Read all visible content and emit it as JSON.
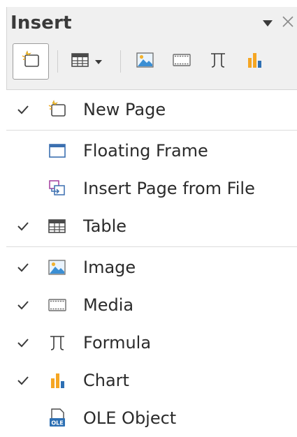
{
  "panel": {
    "title": "Insert",
    "menu_icon": "triangle-down-icon",
    "close_icon": "close-icon"
  },
  "toolbar": {
    "buttons": [
      {
        "id": "new-page",
        "icon": "new-page-icon",
        "active": true
      },
      {
        "id": "table",
        "icon": "table-icon",
        "has_dropdown": true
      },
      {
        "id": "image",
        "icon": "image-icon"
      },
      {
        "id": "media",
        "icon": "media-icon"
      },
      {
        "id": "formula",
        "icon": "formula-icon"
      },
      {
        "id": "chart",
        "icon": "chart-icon"
      }
    ]
  },
  "menu": {
    "items": [
      {
        "label": "New Page",
        "checked": true,
        "icon": "new-page-icon"
      },
      {
        "separator": true
      },
      {
        "label": "Floating Frame",
        "checked": false,
        "icon": "floating-frame-icon"
      },
      {
        "label": "Insert Page from File",
        "checked": false,
        "icon": "insert-page-from-file-icon"
      },
      {
        "label": "Table",
        "checked": true,
        "icon": "table-icon"
      },
      {
        "separator": true
      },
      {
        "label": "Image",
        "checked": true,
        "icon": "image-icon"
      },
      {
        "label": "Media",
        "checked": true,
        "icon": "media-icon"
      },
      {
        "label": "Formula",
        "checked": true,
        "icon": "formula-icon"
      },
      {
        "label": "Chart",
        "checked": true,
        "icon": "chart-icon"
      },
      {
        "label": "OLE Object",
        "checked": false,
        "icon": "ole-object-icon"
      }
    ]
  },
  "colors": {
    "panel_bg": "#f0f0f0",
    "chart_orange": "#f5a623",
    "chart_blue": "#2d6fb3",
    "image_blue": "#3b8fd4",
    "insert_page_purple": "#a23d9e"
  }
}
